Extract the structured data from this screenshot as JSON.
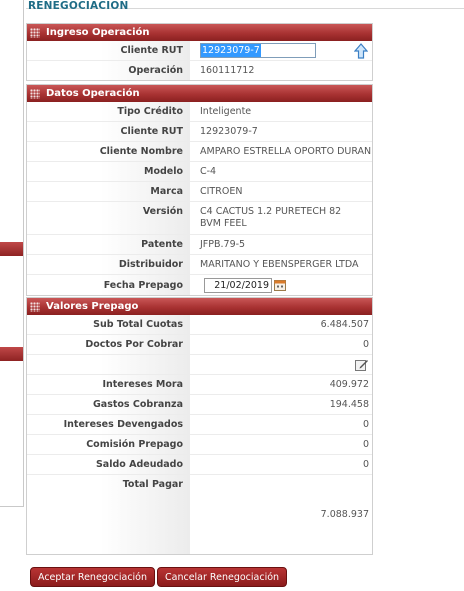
{
  "page_title": "RENEGOCIACION",
  "ingreso": {
    "title": "Ingreso Operación",
    "cliente_rut_label": "Cliente RUT",
    "cliente_rut_value": "12923079-7",
    "operacion_label": "Operación",
    "operacion_value": "160111712",
    "upload_icon": "arrow-up-icon"
  },
  "datos": {
    "title": "Datos Operación",
    "rows": [
      {
        "label": "Tipo Crédito",
        "value": "Inteligente"
      },
      {
        "label": "Cliente RUT",
        "value": "12923079-7"
      },
      {
        "label": "Cliente Nombre",
        "value": "AMPARO ESTRELLA OPORTO DURAN"
      },
      {
        "label": "Modelo",
        "value": "C-4"
      },
      {
        "label": "Marca",
        "value": "CITROEN"
      },
      {
        "label": "Versión",
        "value": "C4 CACTUS 1.2 PURETECH 82 BVM FEEL"
      },
      {
        "label": "Patente",
        "value": "JFPB.79-5"
      },
      {
        "label": "Distribuidor",
        "value": "MARITANO Y EBENSPERGER LTDA"
      }
    ],
    "fecha_label": "Fecha Prepago",
    "fecha_value": "21/02/2019",
    "calendar_icon": "calendar-icon"
  },
  "valores": {
    "title": "Valores Prepago",
    "sub_total_cuotas_label": "Sub Total Cuotas",
    "sub_total_cuotas_value": "6.484.507",
    "doctos_label": "Doctos Por Cobrar",
    "doctos_value": "0",
    "edit_icon": "edit-icon",
    "intereses_mora_label": "Intereses Mora",
    "intereses_mora_value": "409.972",
    "gastos_cobranza_label": "Gastos Cobranza",
    "gastos_cobranza_value": "194.458",
    "intereses_devengados_label": "Intereses Devengados",
    "intereses_devengados_value": "0",
    "comision_label": "Comisión Prepago",
    "comision_value": "0",
    "saldo_label": "Saldo Adeudado",
    "saldo_value": "0",
    "total_label": "Total Pagar",
    "total_value": "7.088.937"
  },
  "buttons": {
    "aceptar": "Aceptar Renegociación",
    "cancelar": "Cancelar Renegociación"
  },
  "colors": {
    "panel_header": "#a83232",
    "title_text": "#1f6c86",
    "selection": "#3399ff"
  }
}
